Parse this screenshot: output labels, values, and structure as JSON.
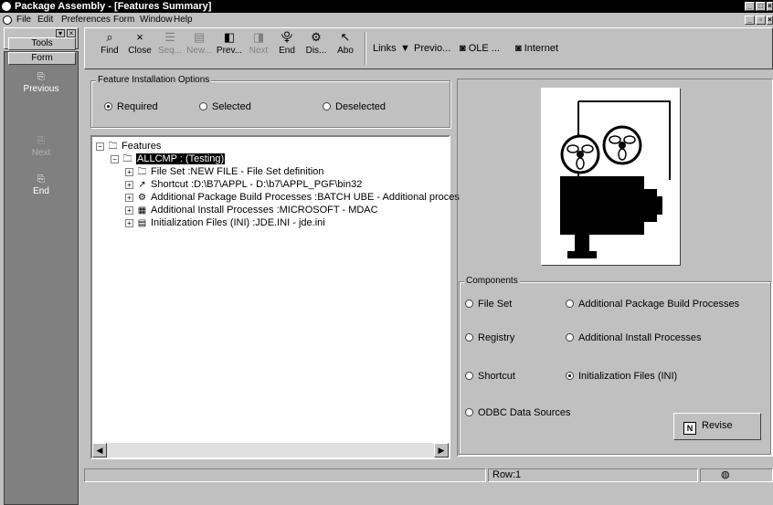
{
  "window": {
    "title": "Package Assembly - [Features Summary]"
  },
  "menu": {
    "items": [
      "File",
      "Edit",
      "Preferences",
      "Form",
      "Window",
      "Help"
    ]
  },
  "left_pane": {
    "tools_label": "Tools",
    "form_label": "Form",
    "buttons": [
      "Previous",
      "Next",
      "End"
    ]
  },
  "toolbar": {
    "buttons": [
      {
        "label": "Find",
        "icon": "find-icon",
        "enabled": true
      },
      {
        "label": "Close",
        "icon": "close-icon",
        "enabled": true
      },
      {
        "label": "Seq...",
        "icon": "sequence-icon",
        "enabled": false
      },
      {
        "label": "New...",
        "icon": "new-icon",
        "enabled": false
      },
      {
        "label": "Prev...",
        "icon": "prev-icon",
        "enabled": true
      },
      {
        "label": "Next",
        "icon": "next-icon",
        "enabled": false
      },
      {
        "label": "End",
        "icon": "end-icon",
        "enabled": true
      },
      {
        "label": "Dis...",
        "icon": "display-icon",
        "enabled": true
      },
      {
        "label": "Abo",
        "icon": "about-icon",
        "enabled": true
      }
    ],
    "links_label": "Links",
    "previo_label": "Previo...",
    "ole_label": "OLE ...",
    "internet_label": "Internet"
  },
  "feature_options": {
    "title": "Feature Installation Options",
    "options": [
      {
        "label": "Required",
        "selected": true
      },
      {
        "label": "Selected",
        "selected": false
      },
      {
        "label": "Deselected",
        "selected": false
      }
    ]
  },
  "tree": {
    "root": "Features",
    "package": "ALLCMP : (Testing)",
    "children": [
      "File Set :NEW FILE - File Set definition",
      "Shortcut :D:\\B7\\APPL - D:\\b7\\APPL_PGF\\bin32",
      "Additional Package Build Processes :BATCH UBE - Additional proces",
      "Additional Install Processes :MICROSOFT - MDAC",
      "Initialization Files (INI) :JDE.INI - jde.ini"
    ]
  },
  "components": {
    "title": "Components",
    "options": [
      {
        "label": "File Set",
        "selected": false
      },
      {
        "label": "Additional Package Build Processes",
        "selected": false
      },
      {
        "label": "Registry",
        "selected": false
      },
      {
        "label": "Additional Install Processes",
        "selected": false
      },
      {
        "label": "Shortcut",
        "selected": false
      },
      {
        "label": "Initialization Files (INI)",
        "selected": true
      },
      {
        "label": "ODBC Data Sources",
        "selected": false
      }
    ],
    "revise_label": "Revise"
  },
  "status": {
    "row_label": "Row:1"
  },
  "colors": {
    "title_bar": "#000000",
    "background": "#c0c0c0",
    "left_pane": "#808080"
  }
}
